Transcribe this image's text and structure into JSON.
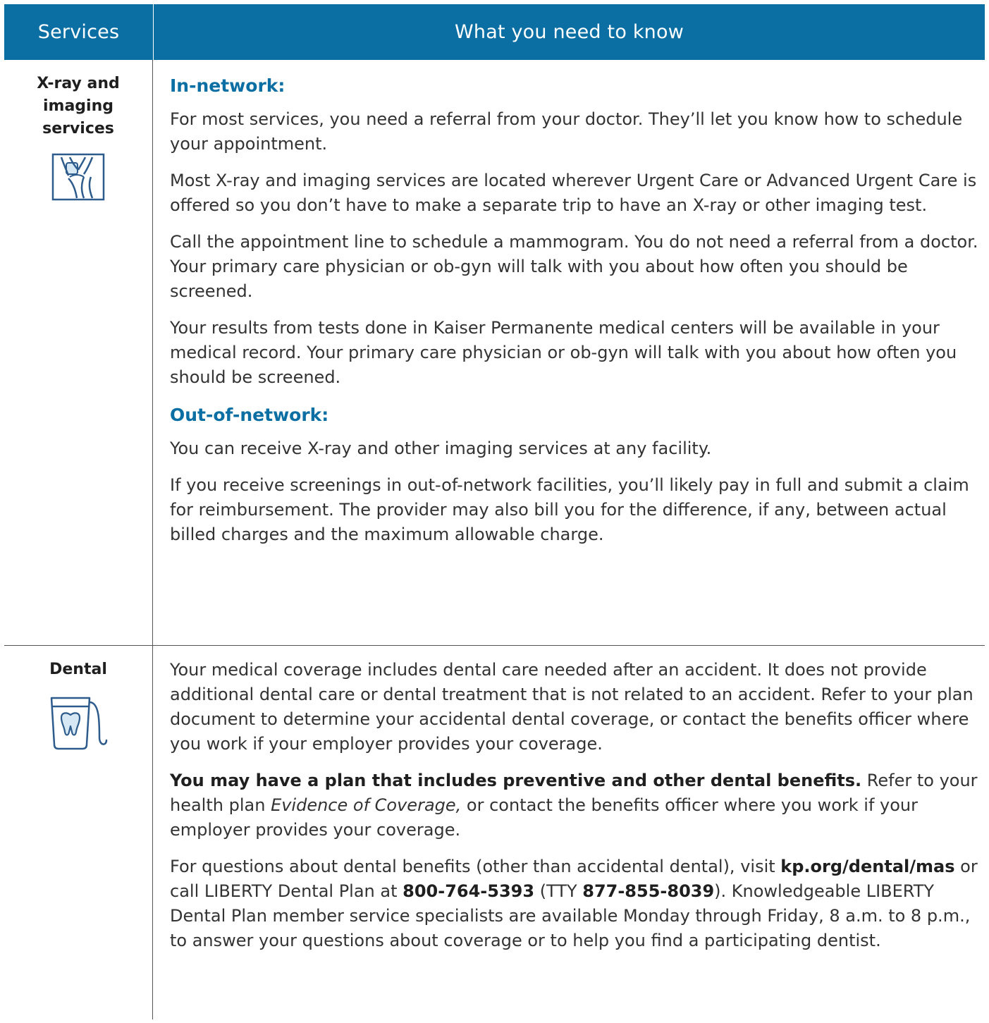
{
  "header": {
    "services": "Services",
    "info": "What you need to know"
  },
  "rows": [
    {
      "service": "X-ray and imaging services",
      "icon": "knee-joint-icon",
      "sections": {
        "in_network_title": "In-network:",
        "in_network_paragraphs": [
          "For most services, you need a referral from your doctor. They’ll let you know how to schedule your appointment.",
          "Most X-ray and imaging services are located wherever Urgent Care or Advanced Urgent Care is offered so you don’t have to make a separate trip to have an X-ray or other imaging test.",
          "Call the appointment line to schedule a mammogram. You do not need a referral from a doctor. Your primary care physician or ob-gyn will talk with you about how often you should be screened.",
          "Your results from tests done in Kaiser Permanente medical centers will be available in your medical record. Your primary care physician or ob-gyn will talk with you about how often you should be screened."
        ],
        "out_network_title": "Out-of-network:",
        "out_network_paragraphs": [
          "You can receive X-ray and other imaging services at any facility.",
          "If you receive screenings in out-of-network facilities, you’ll likely pay in full and submit a claim for reimbursement. The provider may also bill you for the difference, if any, between actual billed charges and the maximum allowable charge."
        ]
      }
    },
    {
      "service": "Dental",
      "icon": "tooth-floss-icon",
      "paragraph1": "Your medical coverage includes dental care needed after an accident. It does not provide additional dental care or dental treatment that is not related to an accident. Refer to your plan document to determine your accidental dental coverage, or contact the benefits officer where you work if your employer provides your coverage.",
      "paragraph2": {
        "bold": "You may have a plan that includes preventive and other dental benefits.",
        "before_italic": " Refer to your health plan ",
        "italic": "Evidence of Coverage,",
        "after_italic": " or contact the benefits officer where you work if your employer provides your coverage."
      },
      "paragraph3": {
        "text1": "For questions about dental benefits (other than accidental dental), visit ",
        "link": "kp.org/dental/mas",
        "text2": " or call LIBERTY Dental Plan at ",
        "phone": "800-764-5393",
        "text3": " (TTY ",
        "tty": "877-855-8039",
        "text4": "). Knowledgeable LIBERTY Dental Plan member service specialists are available Monday through Friday, 8 a.m. to 8 p.m., to answer your questions about coverage or to help you find a participating dentist."
      }
    }
  ],
  "colors": {
    "header_bg": "#0b6fa4",
    "subhead": "#0b6fa4",
    "icon": "#2d5b8c"
  }
}
